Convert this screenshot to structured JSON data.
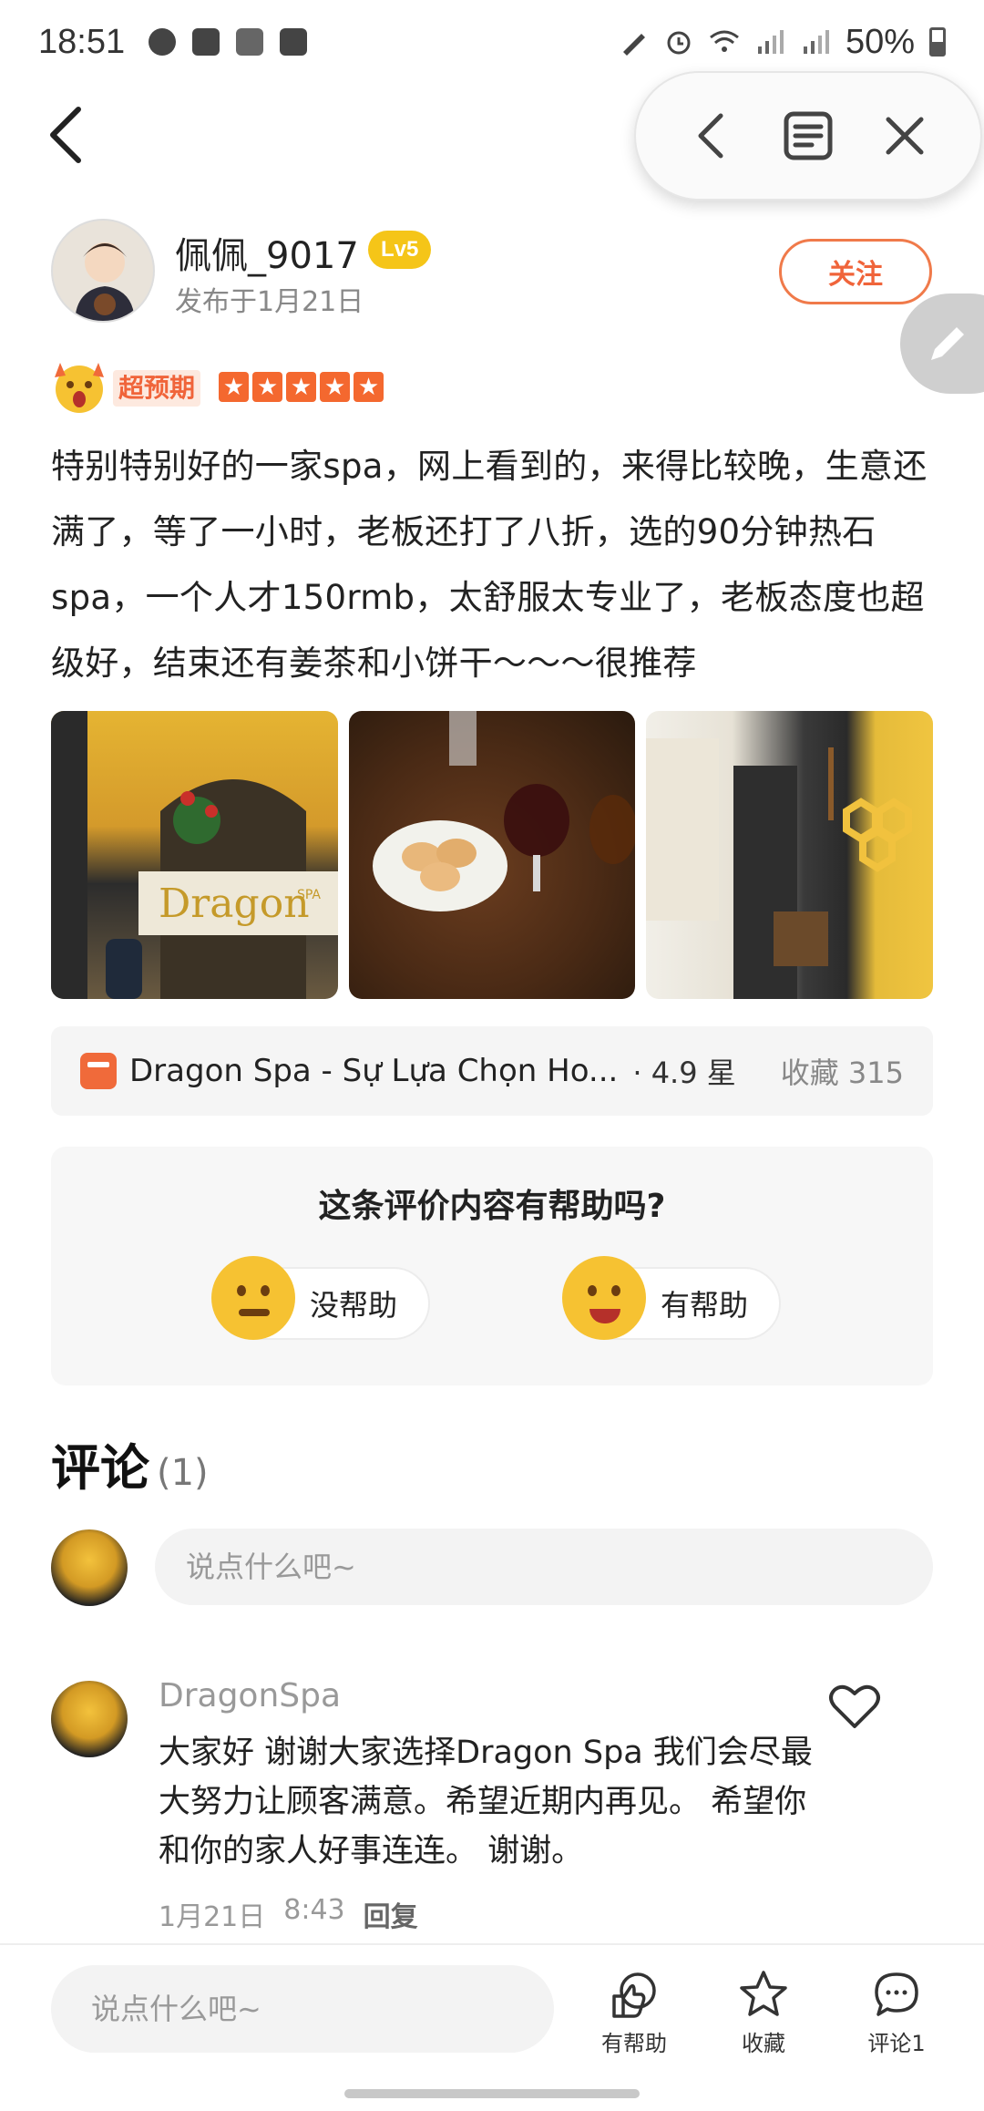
{
  "status_bar": {
    "time": "18:51",
    "battery": "50%",
    "icons": [
      "messenger-icon",
      "gallery-icon",
      "translate-icon",
      "checkbox-icon",
      "pen-icon",
      "alarm-icon",
      "wifi-icon",
      "signal-icon",
      "signal-icon",
      "battery-icon"
    ]
  },
  "author": {
    "name": "佩佩_9017",
    "level": "Lv5",
    "posted": "发布于1月21日",
    "follow_label": "关注"
  },
  "rating": {
    "tag": "超预期",
    "stars": 5,
    "star_glyph": "★"
  },
  "review": {
    "text": "特别特别好的一家spa，网上看到的，来得比较晚，生意还满了，等了一小时，老板还打了八折，选的90分钟热石spa，一个人才150rmb，太舒服太专业了，老板态度也超级好，结束还有姜茶和小饼干～～～很推荐"
  },
  "photos": {
    "signage_brand": "Dragon",
    "signage_suffix": "SPA"
  },
  "place": {
    "name": "Dragon Spa - Sự Lựa Chọn Ho...",
    "rating": "· 4.9 星",
    "favorites": "收藏 315"
  },
  "helpful": {
    "question": "这条评价内容有帮助吗?",
    "no_label": "没帮助",
    "yes_label": "有帮助"
  },
  "comments": {
    "title": "评论",
    "count": "(1)",
    "input_placeholder": "说点什么吧~",
    "items": [
      {
        "author": "DragonSpa",
        "text": "大家好 谢谢大家选择Dragon Spa 我们会尽最大努力让顾客满意。希望近期内再见。 希望你和你的家人好事连连。 谢谢。",
        "date": "1月21日",
        "time": "8:43",
        "reply_label": "回复"
      }
    ]
  },
  "bottom_bar": {
    "input_placeholder": "说点什么吧~",
    "helpful_label": "有帮助",
    "fav_label": "收藏",
    "comment_label": "评论1"
  },
  "colors": {
    "accent": "#f0643a",
    "star": "#f4682f",
    "badge": "#f5c518"
  }
}
